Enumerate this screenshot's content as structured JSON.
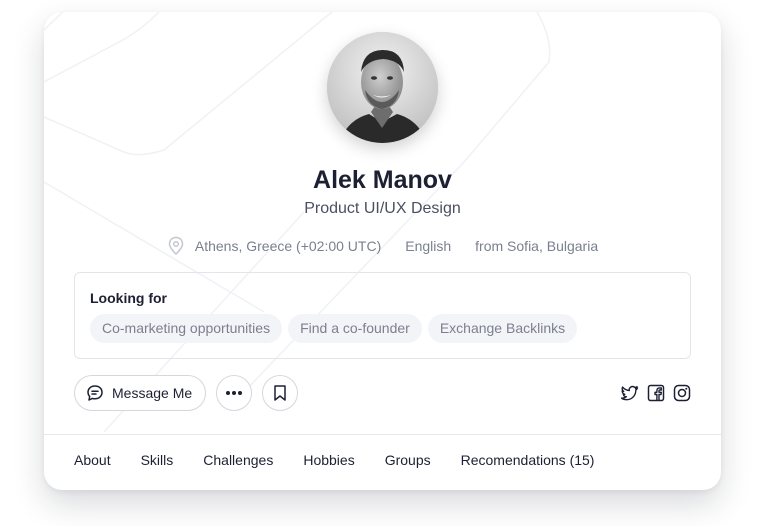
{
  "profile": {
    "name": "Alek Manov",
    "role": "Product UI/UX Design",
    "location": "Athens, Greece (+02:00 UTC)",
    "language": "English",
    "origin": "from Sofia, Bulgaria"
  },
  "looking_for": {
    "title": "Looking for",
    "tags": [
      "Co-marketing opportunities",
      "Find a co-founder",
      "Exchange Backlinks"
    ]
  },
  "actions": {
    "message_label": "Message Me"
  },
  "socials": [
    "twitter-icon",
    "facebook-icon",
    "instagram-icon"
  ],
  "tabs": [
    "About",
    "Skills",
    "Challenges",
    "Hobbies",
    "Groups",
    "Recomendations (15)"
  ],
  "colors": {
    "text_primary": "#1d2033",
    "text_muted": "#7b8090",
    "tag_bg": "#f3f4f7",
    "border": "#d4d7de"
  }
}
